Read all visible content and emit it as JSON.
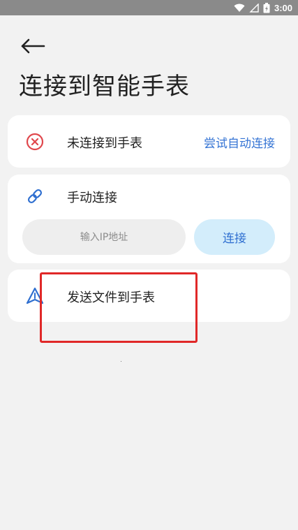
{
  "status_bar": {
    "time": "3:00",
    "icons": [
      "wifi-icon",
      "signal-icon",
      "battery-icon"
    ]
  },
  "header": {
    "back_icon": "arrow-left-icon",
    "title": "连接到智能手表"
  },
  "connection_status": {
    "icon": "error-circle-icon",
    "label": "未连接到手表",
    "action_label": "尝试自动连接"
  },
  "manual_connect": {
    "icon": "link-icon",
    "label": "手动连接",
    "ip_input": {
      "placeholder": "输入IP地址",
      "value": ""
    },
    "connect_label": "连接"
  },
  "send_file": {
    "icon": "send-icon",
    "label": "发送文件到手表"
  },
  "colors": {
    "background": "#f2f2f2",
    "card": "#ffffff",
    "accent": "#3574d4",
    "error": "#e0474c",
    "button_bg": "#d3edfb",
    "highlight": "#e02828"
  }
}
